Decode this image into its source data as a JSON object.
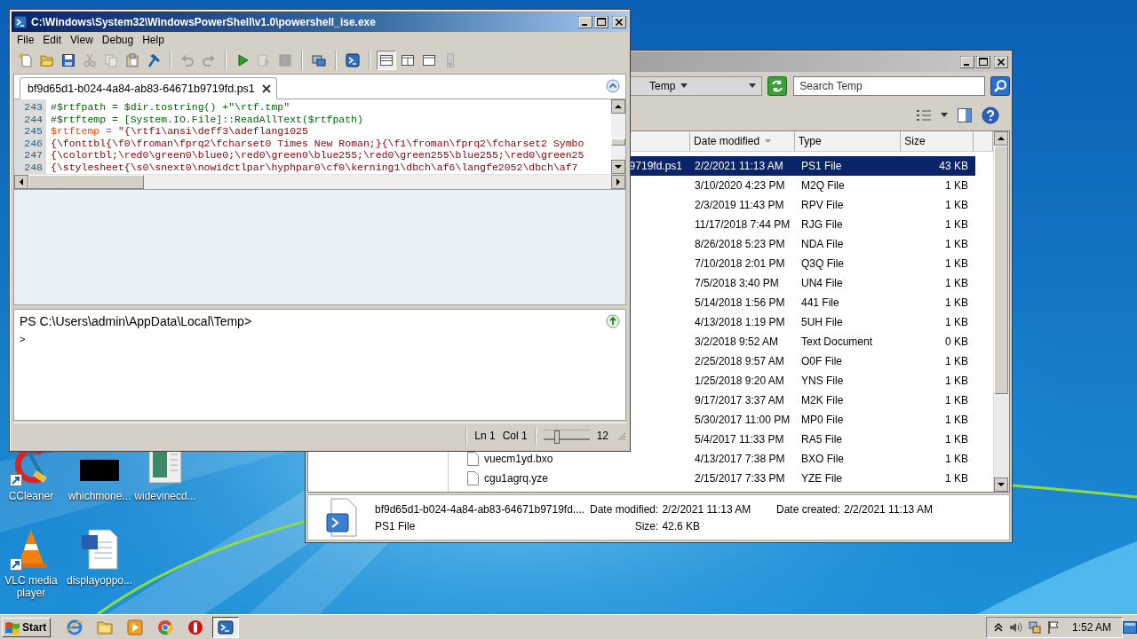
{
  "desktop": {
    "icons": [
      {
        "label": "CCleaner",
        "kind": "ccleaner",
        "shortcut": true
      },
      {
        "label": "whichmone...",
        "kind": "blank",
        "shortcut": false
      },
      {
        "label": "widevinecd...",
        "kind": "sheet",
        "shortcut": false
      },
      {
        "label": "VLC media player",
        "kind": "cone",
        "shortcut": true
      },
      {
        "label": "displayoppo...",
        "kind": "document",
        "shortcut": false
      }
    ]
  },
  "ise": {
    "title": "C:\\Windows\\System32\\WindowsPowerShell\\v1.0\\powershell_ise.exe",
    "menu": [
      "File",
      "Edit",
      "View",
      "Debug",
      "Help"
    ],
    "toolbar": [
      {
        "kind": "new",
        "disabled": false,
        "selected": false,
        "starts_group": false
      },
      {
        "kind": "open",
        "disabled": false,
        "selected": false,
        "starts_group": false
      },
      {
        "kind": "save",
        "disabled": false,
        "selected": false,
        "starts_group": false
      },
      {
        "kind": "cut",
        "disabled": true,
        "selected": false,
        "starts_group": false
      },
      {
        "kind": "copy",
        "disabled": true,
        "selected": false,
        "starts_group": false
      },
      {
        "kind": "paste",
        "disabled": false,
        "selected": false,
        "starts_group": false
      },
      {
        "kind": "clear",
        "disabled": false,
        "selected": false,
        "starts_group": false
      },
      {
        "kind": "undo",
        "disabled": true,
        "selected": false,
        "starts_group": true
      },
      {
        "kind": "redo",
        "disabled": true,
        "selected": false,
        "starts_group": false
      },
      {
        "kind": "run",
        "disabled": false,
        "selected": false,
        "starts_group": true
      },
      {
        "kind": "runsel",
        "disabled": true,
        "selected": false,
        "starts_group": false
      },
      {
        "kind": "stop",
        "disabled": true,
        "selected": false,
        "starts_group": false
      },
      {
        "kind": "remote",
        "disabled": false,
        "selected": false,
        "starts_group": true
      },
      {
        "kind": "ps",
        "disabled": false,
        "selected": false,
        "starts_group": true
      },
      {
        "kind": "layout_top",
        "disabled": false,
        "selected": true,
        "starts_group": true
      },
      {
        "kind": "layout_side",
        "disabled": false,
        "selected": false,
        "starts_group": false
      },
      {
        "kind": "layout_max",
        "disabled": false,
        "selected": false,
        "starts_group": false
      },
      {
        "kind": "more",
        "disabled": true,
        "selected": false,
        "starts_group": false
      }
    ],
    "tab": {
      "label": "bf9d65d1-b024-4a84-ab83-64671b9719fd.ps1",
      "selected": true
    },
    "lines": [
      {
        "number": "243",
        "tokens": [
          {
            "kind": "comment",
            "text": "#$rtfpath = $dir.tostring() +\"\\rtf.tmp\""
          }
        ]
      },
      {
        "number": "244",
        "tokens": [
          {
            "kind": "comment",
            "text": "#$rtftemp = [System.IO.File]::ReadAllText($rtfpath)"
          }
        ]
      },
      {
        "number": "245",
        "tokens": [
          {
            "kind": "variable",
            "text": "$rtftemp"
          },
          {
            "kind": "operator",
            "text": " = "
          },
          {
            "kind": "string",
            "text": "\"{\\rtf1\\ansi\\deff3\\adeflang1025"
          }
        ]
      },
      {
        "number": "246",
        "tokens": [
          {
            "kind": "string",
            "text": "{\\fonttbl{\\f0\\froman\\fprq2\\fcharset0 Times New Roman;}{\\f1\\froman\\fprq2\\fcharset2 Symbo"
          }
        ]
      },
      {
        "number": "247",
        "tokens": [
          {
            "kind": "string",
            "text": "{\\colortbl;\\red0\\green0\\blue0;\\red0\\green0\\blue255;\\red0\\green255\\blue255;\\red0\\green25"
          }
        ]
      },
      {
        "number": "248",
        "tokens": [
          {
            "kind": "string",
            "text": "{\\stylesheet{\\s0\\snext0\\nowidctlpar\\hyphpar0\\cf0\\kerning1\\dbch\\af6\\langfe2052\\dbch\\af7"
          }
        ]
      }
    ],
    "console": {
      "prompt": "PS C:\\Users\\admin\\AppData\\Local\\Temp>",
      "input": ">"
    },
    "status": {
      "line": "Ln 1",
      "column": "Col 1",
      "zoom": {
        "level": 0.3,
        "reading": "12"
      }
    }
  },
  "explorer": {
    "breadcrumb": "Temp",
    "search": {
      "placeholder": "Search Temp"
    },
    "columns": [
      {
        "label": "Date modified",
        "sorted": true
      },
      {
        "label": "Type",
        "sorted": false
      },
      {
        "label": "Size",
        "sorted": false
      }
    ],
    "rows": [
      {
        "name": "9719fd.ps1",
        "icon": false,
        "date": "2/2/2021 11:13 AM",
        "type": "PS1 File",
        "size": "43 KB",
        "selected": true
      },
      {
        "date": "3/10/2020 4:23 PM",
        "type": "M2Q File",
        "size": "1 KB",
        "selected": false
      },
      {
        "date": "2/3/2019 11:43 PM",
        "type": "RPV File",
        "size": "1 KB",
        "selected": false
      },
      {
        "date": "11/17/2018 7:44 PM",
        "type": "RJG File",
        "size": "1 KB",
        "selected": false
      },
      {
        "date": "8/26/2018 5:23 PM",
        "type": "NDA File",
        "size": "1 KB",
        "selected": false
      },
      {
        "date": "7/10/2018 2:01 PM",
        "type": "Q3Q File",
        "size": "1 KB",
        "selected": false
      },
      {
        "date": "7/5/2018 3:40 PM",
        "type": "UN4 File",
        "size": "1 KB",
        "selected": false
      },
      {
        "date": "5/14/2018 1:56 PM",
        "type": "441 File",
        "size": "1 KB",
        "selected": false
      },
      {
        "date": "4/13/2018 1:19 PM",
        "type": "5UH File",
        "size": "1 KB",
        "selected": false
      },
      {
        "date": "3/2/2018 9:52 AM",
        "type": "Text Document",
        "size": "0 KB",
        "selected": false
      },
      {
        "date": "2/25/2018 9:57 AM",
        "type": "O0F File",
        "size": "1 KB",
        "selected": false
      },
      {
        "date": "1/25/2018 9:20 AM",
        "type": "YNS File",
        "size": "1 KB",
        "selected": false
      },
      {
        "date": "9/17/2017 3:37 AM",
        "type": "M2K File",
        "size": "1 KB",
        "selected": false
      },
      {
        "date": "5/30/2017 11:00 PM",
        "type": "MP0 File",
        "size": "1 KB",
        "selected": false
      },
      {
        "date": "5/4/2017 11:33 PM",
        "type": "RA5 File",
        "size": "1 KB",
        "selected": false
      },
      {
        "name": "vuecm1yd.bxo",
        "icon": true,
        "date": "4/13/2017 7:38 PM",
        "type": "BXO File",
        "size": "1 KB",
        "selected": false
      },
      {
        "name": "cgu1agrq.yze",
        "icon": true,
        "date": "2/15/2017 7:33 PM",
        "type": "YZE File",
        "size": "1 KB",
        "selected": false
      }
    ],
    "details": {
      "name": "bf9d65d1-b024-4a84-ab83-64671b9719fd....",
      "type": "PS1 File",
      "properties": [
        {
          "label": "Date modified:",
          "value": "2/2/2021 11:13 AM"
        },
        {
          "label": "Size:",
          "value": "42.6 KB"
        },
        {
          "label": "Date created:",
          "value": "2/2/2021 11:13 AM"
        }
      ]
    }
  },
  "taskbar": {
    "start": "Start",
    "apps": [
      {
        "kind": "ie",
        "active": false
      },
      {
        "kind": "folder",
        "active": false
      },
      {
        "kind": "media",
        "active": false
      },
      {
        "kind": "chrome",
        "active": false
      },
      {
        "kind": "red",
        "active": false
      },
      {
        "kind": "ise",
        "active": true
      }
    ],
    "clock": "1:52 AM"
  }
}
